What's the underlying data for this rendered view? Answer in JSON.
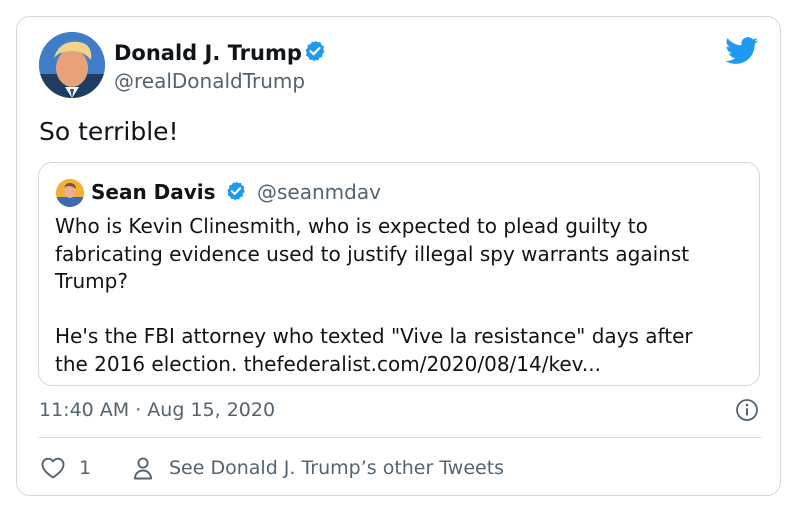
{
  "tweet": {
    "author_name": "Donald J. Trump",
    "author_handle": "@realDonaldTrump",
    "text": "So terrible!",
    "timestamp": "11:40 AM · Aug 15, 2020",
    "like_count": "1",
    "other_tweets_link": "See Donald J. Trump’s other Tweets"
  },
  "quoted_tweet": {
    "author_name": "Sean Davis",
    "author_handle": "@seanmdav",
    "text": "Who is Kevin Clinesmith, who is expected to plead guilty to\nfabricating evidence used to justify illegal spy warrants against\nTrump?\n\nHe's the FBI attorney who texted \"Vive la resistance\" days after\nthe 2016 election. thefederalist.com/2020/08/14/kev..."
  },
  "icons": {
    "brand": "twitter-bird-icon",
    "verified": "verified-badge-icon",
    "info": "info-icon",
    "like": "heart-icon",
    "profile": "person-icon"
  },
  "colors": {
    "accent": "#1d9bf0",
    "text": "#0f1419",
    "secondary": "#536471",
    "border": "#cfd9de"
  }
}
